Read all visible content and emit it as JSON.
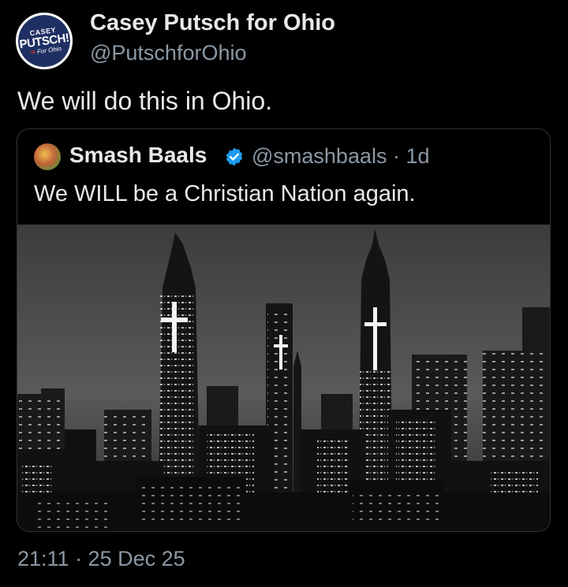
{
  "post": {
    "author": {
      "name": "Casey Putsch for Ohio",
      "handle": "@PutschforOhio",
      "avatar": {
        "top": "CASEY",
        "main": "PUTSCH!",
        "sub": "For Ohio"
      }
    },
    "text": "We will do this in Ohio.",
    "timestamp": "21:11 · 25 Dec 25"
  },
  "quote": {
    "author": {
      "name": "Smash Baals",
      "handle_line": "@smashbaals · 1d",
      "verified_icon": "verified-badge-icon"
    },
    "text": "We WILL be a Christian Nation again.",
    "image": "black-and-white night skyline with illuminated crosses on skyscrapers"
  },
  "colors": {
    "background": "#000000",
    "primary_text": "#e7e9ea",
    "secondary_text": "#8b98a5",
    "card_border": "#2f3336",
    "verified_blue": "#1d9bf0",
    "avatar_navy": "#1e2f63",
    "avatar_red": "#d0312d"
  }
}
